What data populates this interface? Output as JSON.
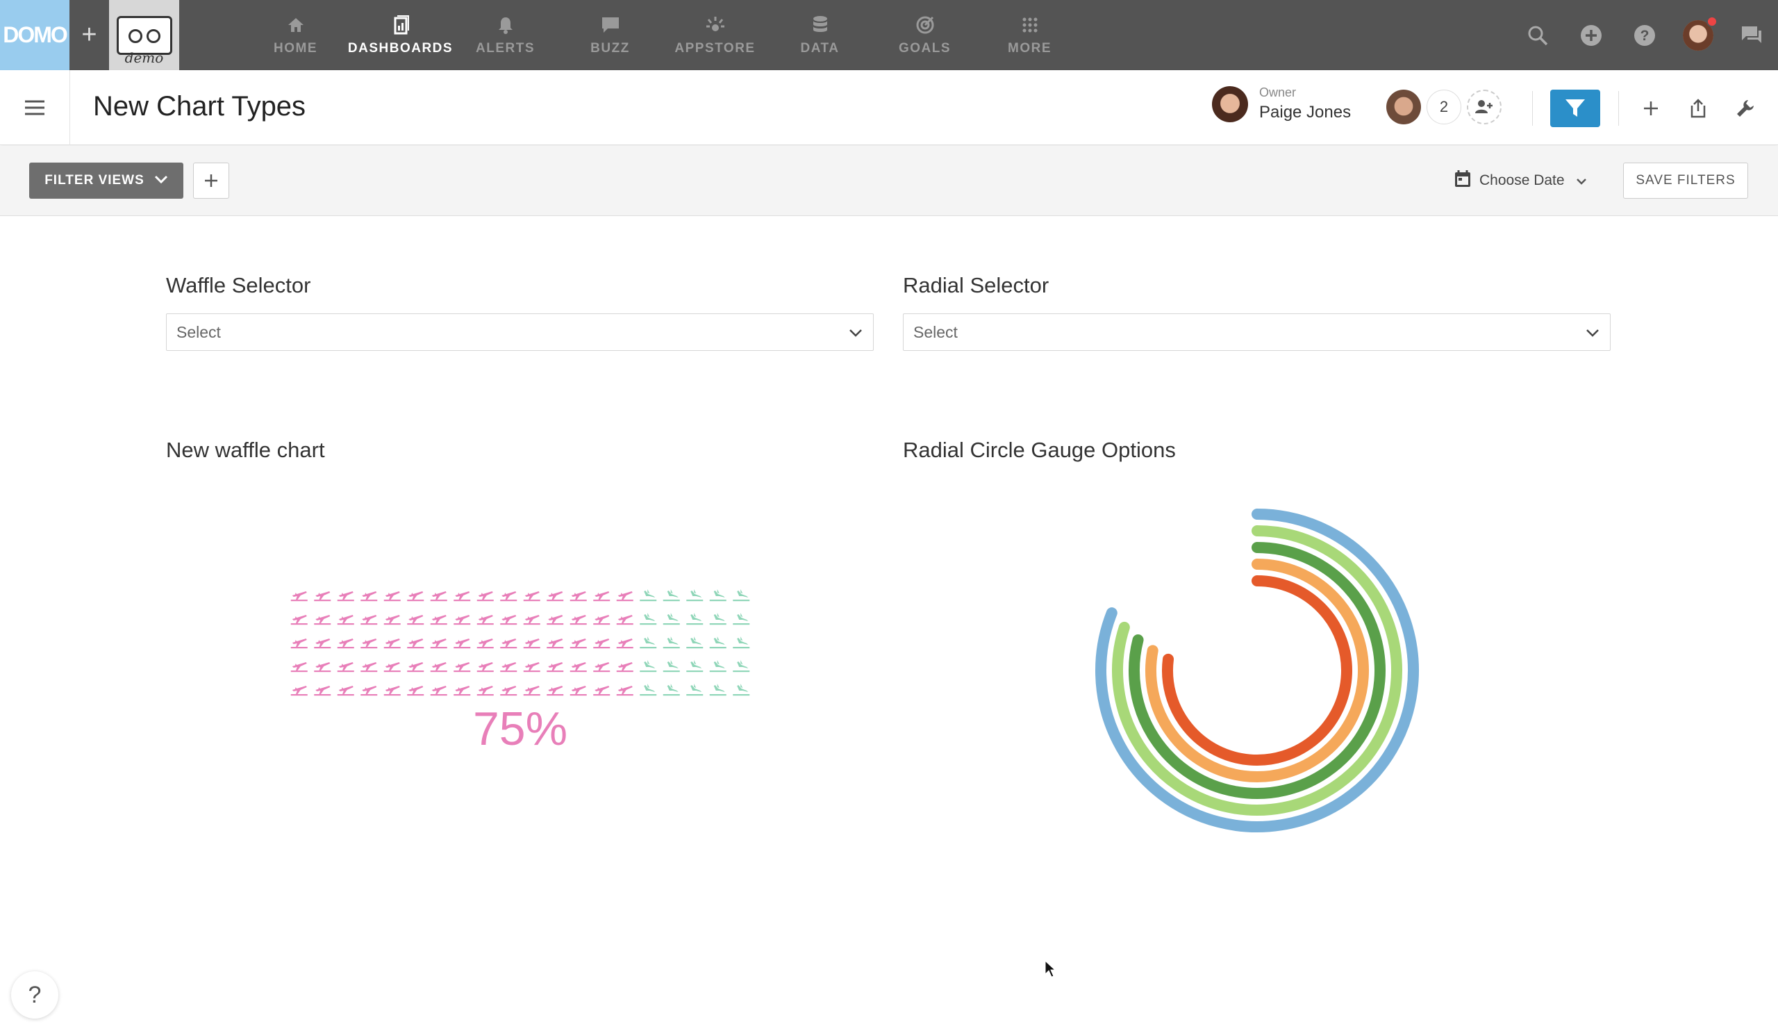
{
  "topnav": {
    "logo_text": "DOMO",
    "brand_tile_text": "demo",
    "items": [
      {
        "label": "HOME",
        "icon": "home-icon"
      },
      {
        "label": "DASHBOARDS",
        "icon": "dashboards-icon",
        "active": true
      },
      {
        "label": "ALERTS",
        "icon": "bell-icon"
      },
      {
        "label": "BUZZ",
        "icon": "chat-icon"
      },
      {
        "label": "APPSTORE",
        "icon": "appstore-icon"
      },
      {
        "label": "DATA",
        "icon": "database-icon"
      },
      {
        "label": "GOALS",
        "icon": "target-icon"
      },
      {
        "label": "MORE",
        "icon": "grid-icon"
      }
    ]
  },
  "titlebar": {
    "title": "New Chart Types",
    "owner_label": "Owner",
    "owner_name": "Paige Jones",
    "shared_count": "2"
  },
  "filterbar": {
    "filter_views_label": "FILTER VIEWS",
    "choose_date_label": "Choose Date",
    "save_filters_label": "SAVE FILTERS"
  },
  "selectors": {
    "waffle_label": "Waffle Selector",
    "waffle_placeholder": "Select",
    "radial_label": "Radial Selector",
    "radial_placeholder": "Select"
  },
  "cards": {
    "waffle_title": "New waffle chart",
    "radial_title": "Radial Circle Gauge Options"
  },
  "help_label": "?",
  "colors": {
    "nav_bg": "#545454",
    "accent": "#2b8fc9",
    "waffle_filled": "#e87fb9",
    "waffle_empty": "#8fd6b8"
  },
  "chart_data": [
    {
      "type": "waffle",
      "rows": 5,
      "cols": 20,
      "filled_fraction": 0.75,
      "value_label": "75%",
      "icon": "airplane-icon",
      "colors": {
        "filled": "#e87fb9",
        "empty": "#8fd6b8"
      }
    },
    {
      "type": "radial-gauge",
      "rings": [
        {
          "color": "#7ab1d9",
          "value": 0.81
        },
        {
          "color": "#a8d878",
          "value": 0.8
        },
        {
          "color": "#5aa04a",
          "value": 0.79
        },
        {
          "color": "#f5a85a",
          "value": 0.78
        },
        {
          "color": "#e55a2a",
          "value": 0.77
        }
      ]
    }
  ]
}
